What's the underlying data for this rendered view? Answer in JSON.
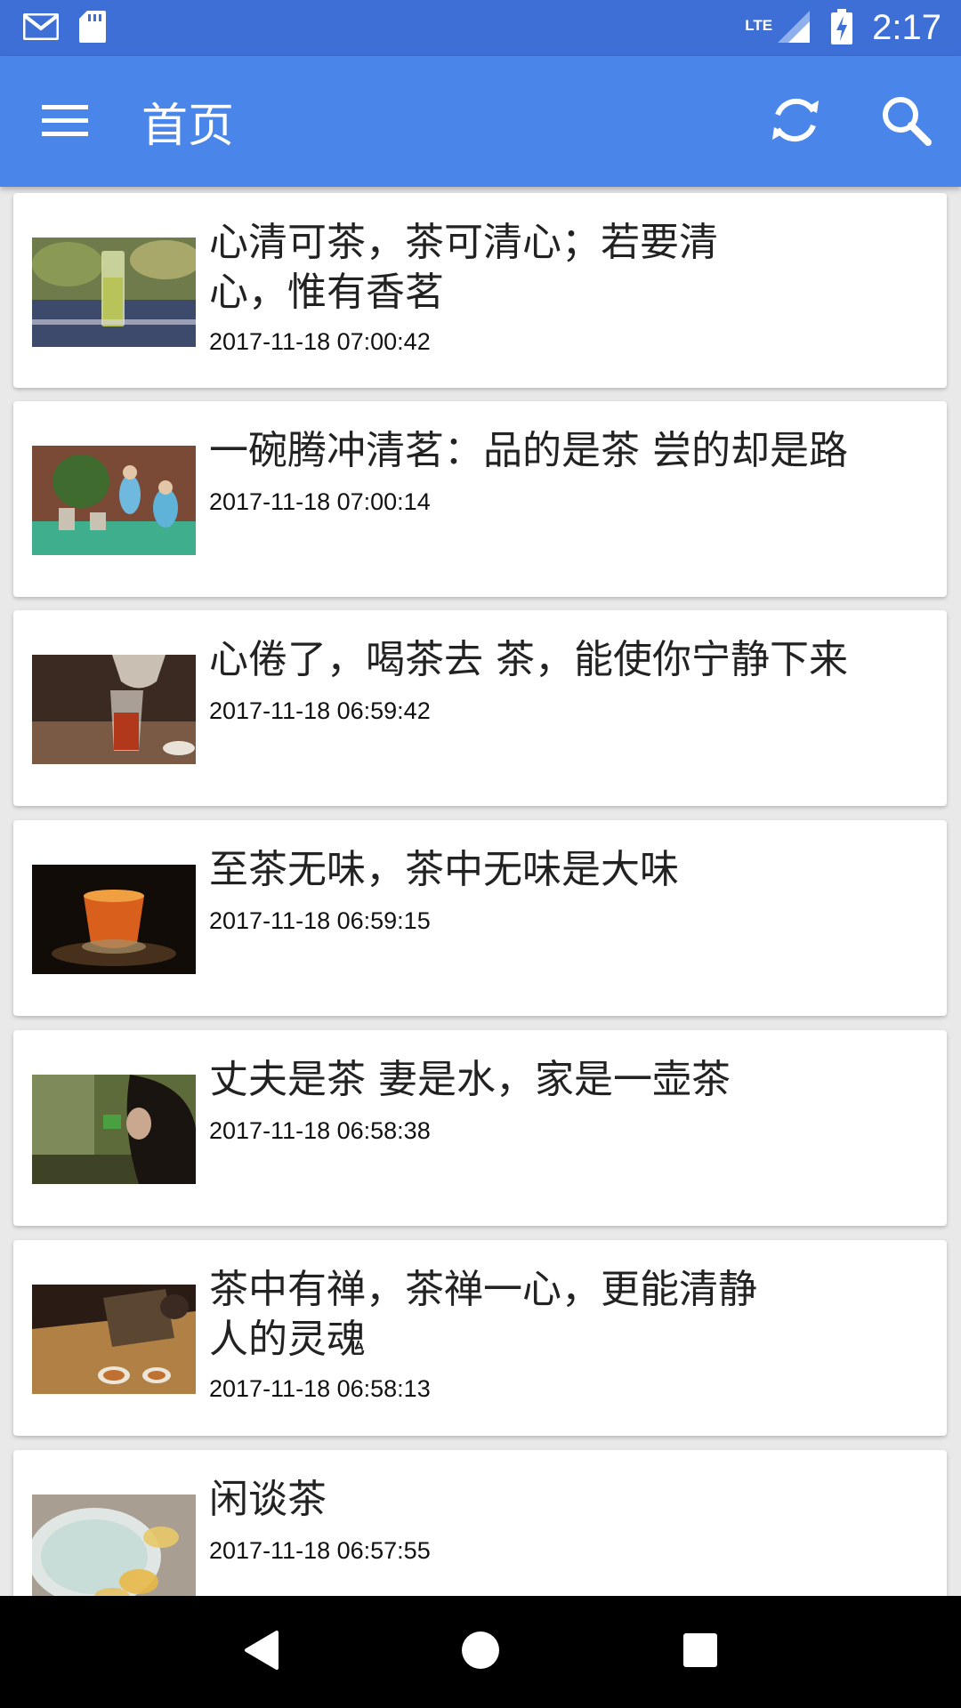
{
  "status_bar": {
    "time": "2:17",
    "network": "LTE",
    "icons": [
      "gmail-icon",
      "sd-card-icon",
      "signal-icon",
      "battery-charging-icon"
    ]
  },
  "app_bar": {
    "title": "首页",
    "icons": [
      "menu-icon",
      "refresh-icon",
      "search-icon"
    ],
    "color": "#4a86ea"
  },
  "articles": [
    {
      "title": "心清可茶，茶可清心；若要清心，惟有香茗",
      "date": "2017-11-18 07:00:42"
    },
    {
      "title": "一碗腾冲清茗：品的是茶 尝的却是路",
      "date": "2017-11-18 07:00:14"
    },
    {
      "title": "心倦了，喝茶去 茶，能使你宁静下来",
      "date": "2017-11-18 06:59:42"
    },
    {
      "title": "至茶无味，茶中无味是大味",
      "date": "2017-11-18 06:59:15"
    },
    {
      "title": "丈夫是茶 妻是水，家是一壶茶",
      "date": "2017-11-18 06:58:38"
    },
    {
      "title": "茶中有禅，茶禅一心，更能清静人的灵魂",
      "date": "2017-11-18 06:58:13"
    },
    {
      "title": "闲谈茶",
      "date": "2017-11-18 06:57:55"
    }
  ],
  "nav_bar": {
    "icons": [
      "back-icon",
      "home-icon",
      "recents-icon"
    ]
  }
}
